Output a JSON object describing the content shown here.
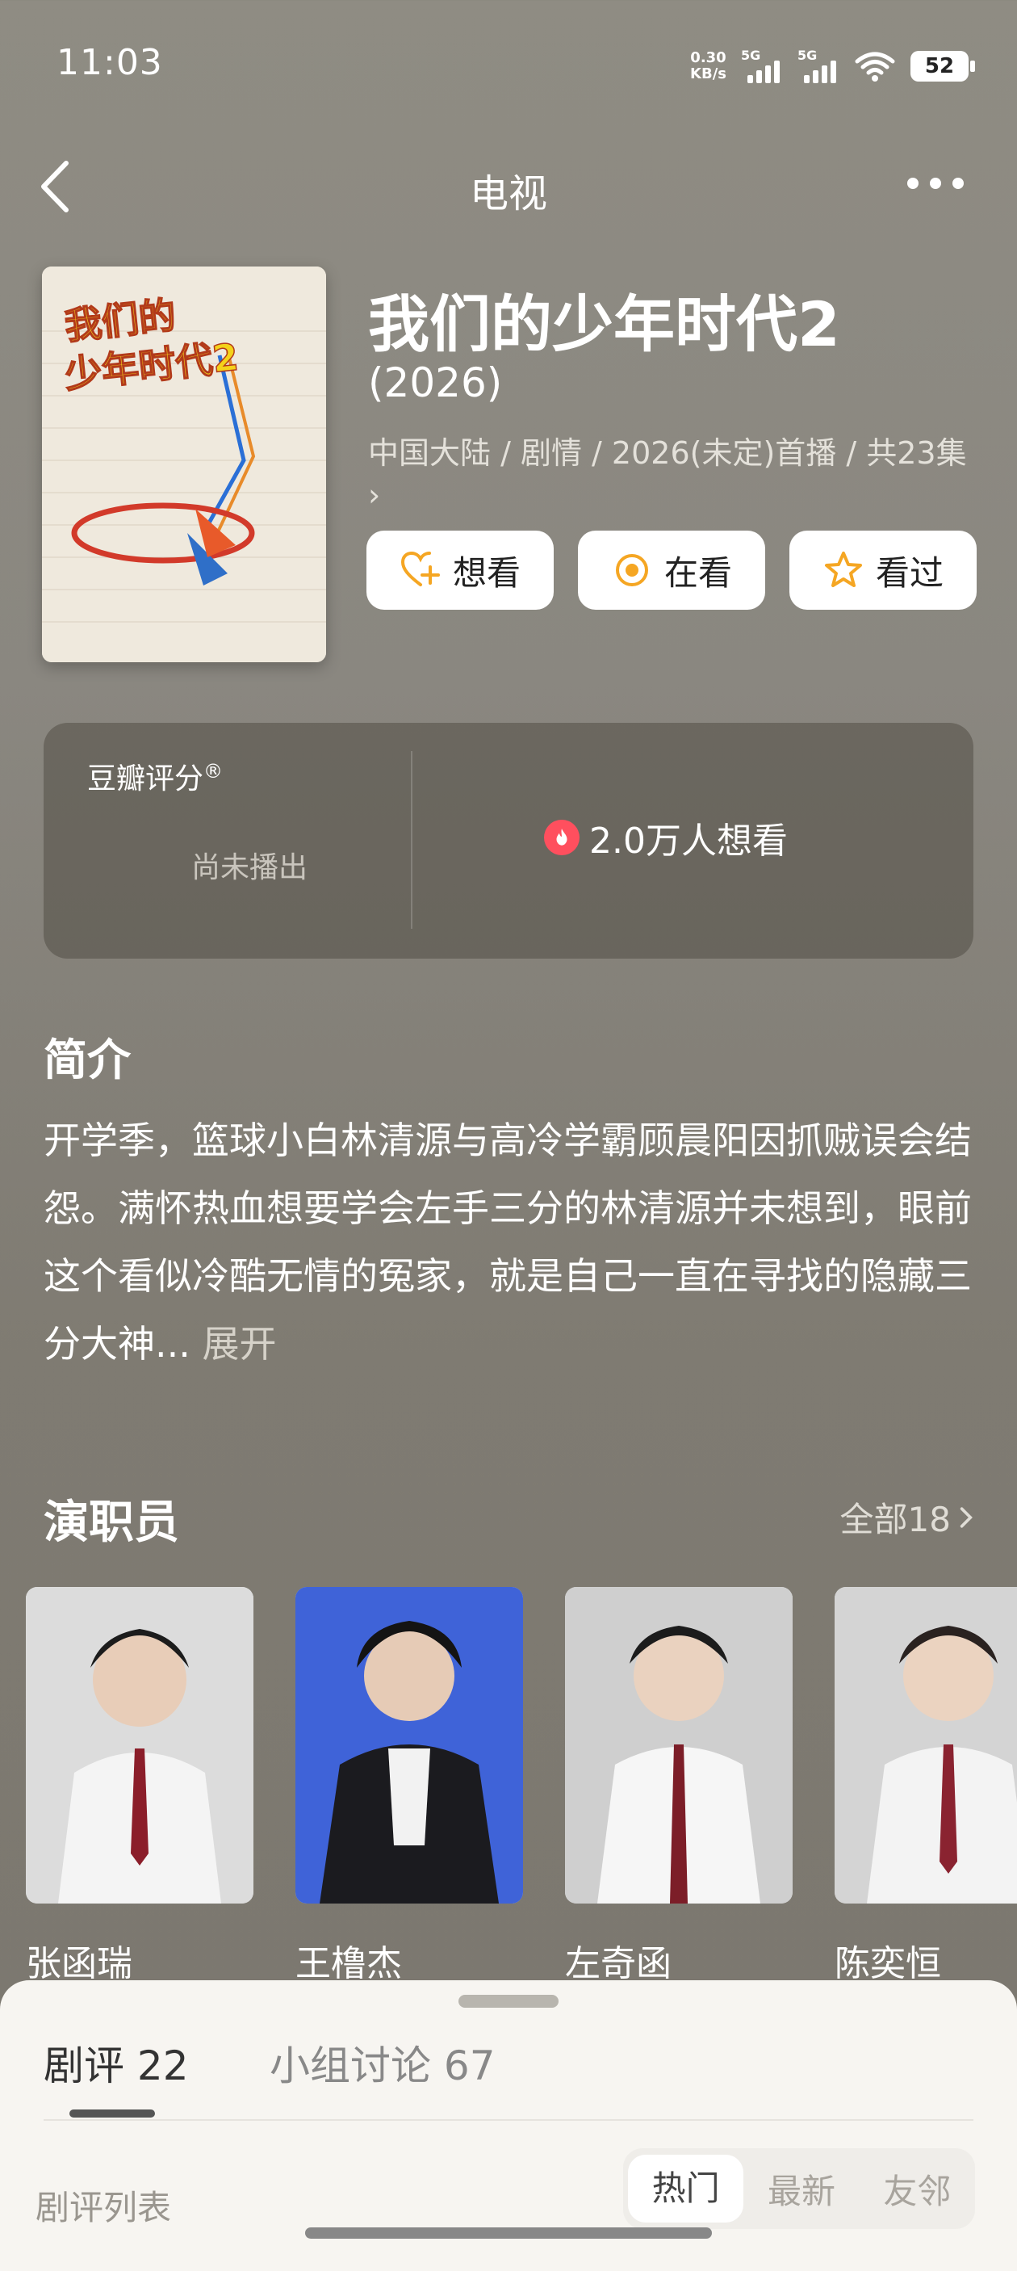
{
  "status_bar": {
    "time": "11:03",
    "net_speed_value": "0.30",
    "net_speed_unit": "KB/s",
    "sim1": "5G",
    "sim2": "5G",
    "battery": "52"
  },
  "nav": {
    "title": "电视"
  },
  "show": {
    "title": "我们的少年时代2",
    "year": "(2026)",
    "meta": "中国大陆 / 剧情 / 2026(未定)首播 / 共23集 ›",
    "poster_text": "我们的少年时代2"
  },
  "actions": [
    {
      "label": "想看",
      "icon": "heart-plus-icon"
    },
    {
      "label": "在看",
      "icon": "target-circle-icon"
    },
    {
      "label": "看过",
      "icon": "star-outline-icon"
    }
  ],
  "rating": {
    "label": "豆瓣评分",
    "mark": "®",
    "status": "尚未播出",
    "want_count": "2.0万人想看"
  },
  "intro": {
    "heading": "简介",
    "text": "开学季，篮球小白林清源与高冷学霸顾晨阳因抓贼误会结怨。满怀热血想要学会左手三分的林清源并未想到，眼前这个看似冷酷无情的冤家，就是自己一直在寻找的隐藏三分大神...",
    "expand": "展开"
  },
  "cast": {
    "heading": "演职员",
    "all_label": "全部18",
    "members": [
      {
        "name": "张函瑞"
      },
      {
        "name": "王橹杰"
      },
      {
        "name": "左奇函"
      },
      {
        "name": "陈奕恒"
      }
    ]
  },
  "sheet": {
    "tab_reviews": "剧评 22",
    "tab_groups": "小组讨论 67",
    "list_label": "剧评列表",
    "sort_options": [
      "热门",
      "最新",
      "友邻"
    ]
  },
  "colors": {
    "accent_orange": "#f5a623",
    "fire_red": "#ff4f5e",
    "background": "#8a8780"
  }
}
